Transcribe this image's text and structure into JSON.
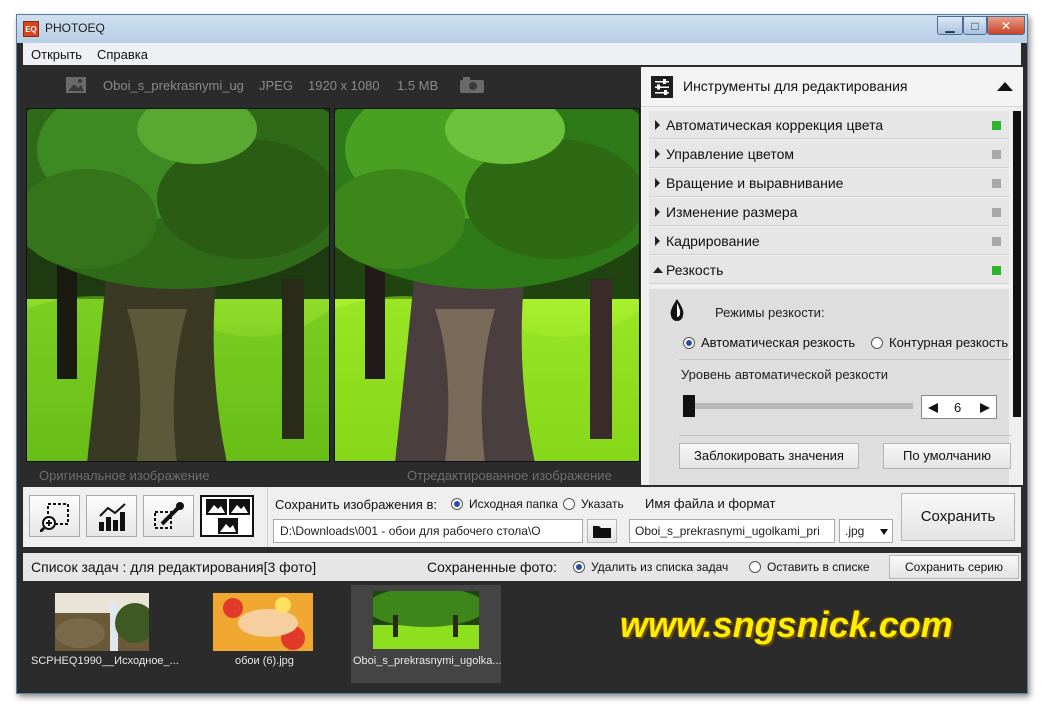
{
  "window": {
    "title": "PHOTOEQ",
    "logo_text": "EQ",
    "controls": [
      "▁",
      "□",
      "✕"
    ]
  },
  "menu": [
    "Открыть",
    "Справка"
  ],
  "image_info": {
    "name": "Oboi_s_prekrasnymi_ug",
    "format": "JPEG",
    "dimensions": "1920 x 1080",
    "size": "1.5 MB"
  },
  "preview": {
    "original_caption": "Оригинальное изображение",
    "edited_caption": "Отредактированное изображение"
  },
  "tools": {
    "title": "Инструменты для редактирования",
    "items": [
      {
        "label": "Автоматическая коррекция цвета",
        "active": true
      },
      {
        "label": "Управление цветом",
        "active": false
      },
      {
        "label": "Вращение и выравнивание",
        "active": false
      },
      {
        "label": "Изменение размера",
        "active": false
      },
      {
        "label": "Кадрирование",
        "active": false
      },
      {
        "label": "Резкость",
        "active": true
      }
    ],
    "sharpness": {
      "modes_label": "Режимы резкости:",
      "auto_label": "Автоматическая резкость",
      "contour_label": "Контурная резкость",
      "level_label": "Уровень автоматической резкости",
      "value": "6",
      "level_fraction": 0.0,
      "lock_button": "Заблокировать значения",
      "default_button": "По умолчанию"
    }
  },
  "save": {
    "label": "Сохранить изображения в:",
    "source_folder": "Исходная папка",
    "specify": "Указать",
    "path": "D:\\Downloads\\001 - обои для рабочего стола\\О",
    "filename_label": "Имя файла и формат",
    "filename": "Oboi_s_prekrasnymi_ugolkami_pri",
    "format": ".jpg",
    "save_button": "Сохранить"
  },
  "tasks": {
    "title": "Список задач : для редактирования[3 фото]",
    "saved_label": "Сохраненные фото:",
    "delete_option": "Удалить из списка задач",
    "keep_option": "Оставить в списке",
    "save_series": "Сохранить серию",
    "items": [
      {
        "label": "SCPHEQ1990__Исходное_..."
      },
      {
        "label": "обои (6).jpg"
      },
      {
        "label": "Oboi_s_prekrasnymi_ugolka..."
      }
    ]
  },
  "watermark": "www.sngsnick.com",
  "colors": {
    "active_indicator": "#2bb52b",
    "inactive_indicator": "#a8a8a8",
    "dark_bg": "#2b2b2b",
    "watermark": "#ffee00"
  }
}
